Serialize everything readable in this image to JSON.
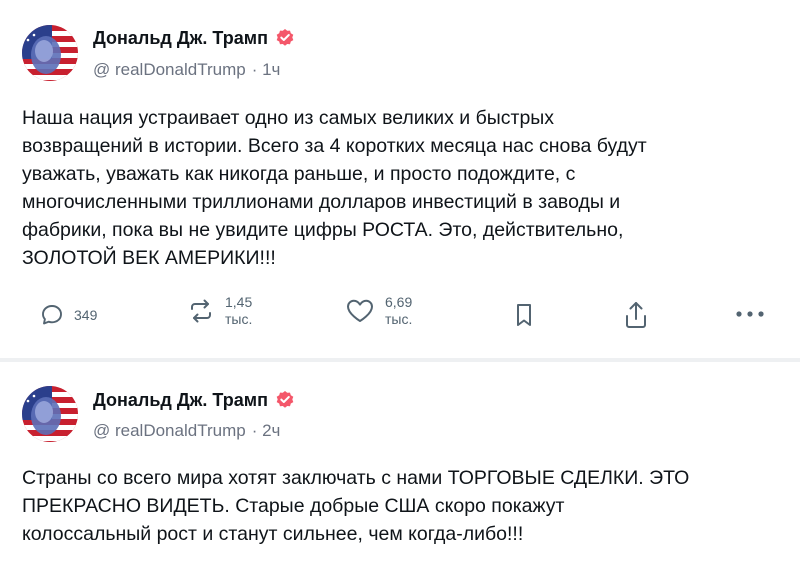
{
  "posts": [
    {
      "author": {
        "display_name": "Дональд Дж. Трамп",
        "handle": "@ realDonaldTrump",
        "time": "· 1ч",
        "verified_color": "#f4576a"
      },
      "text": "Наша нация устраивает одно из самых великих и быстрых\nвозвращений в истории. Всего за 4 коротких месяца нас снова будут\nуважать, уважать как никогда раньше, и просто подождите, с\nмногочисленными триллионами долларов инвестиций в заводы и\nфабрики, пока вы не увидите цифры РОСТА. Это, действительно,\nЗОЛОТОЙ ВЕК АМЕРИКИ!!!",
      "actions": {
        "replies": "349",
        "reposts_value": "1,45",
        "reposts_unit": "тыс.",
        "likes_value": "6,69",
        "likes_unit": "тыс."
      }
    },
    {
      "author": {
        "display_name": "Дональд Дж. Трамп",
        "handle": "@ realDonaldTrump",
        "time": "· 2ч",
        "verified_color": "#f4576a"
      },
      "text": "Страны со всего мира хотят заключать с нами ТОРГОВЫЕ СДЕЛКИ. ЭТО\nПРЕКРАСНО ВИДЕТЬ. Старые добрые США скоро покажут\nколоссальный рост и станут сильнее, чем когда-либо!!!"
    }
  ],
  "icons": {
    "reply": "speech-bubble-icon",
    "repost": "repost-arrows-icon",
    "like": "heart-icon",
    "bookmark": "bookmark-icon",
    "share": "share-upload-icon",
    "more": "ellipsis-icon",
    "verified": "verified-badge-icon"
  },
  "colors": {
    "text": "#0f1419",
    "muted": "#536471",
    "separator": "#eef0f2"
  }
}
